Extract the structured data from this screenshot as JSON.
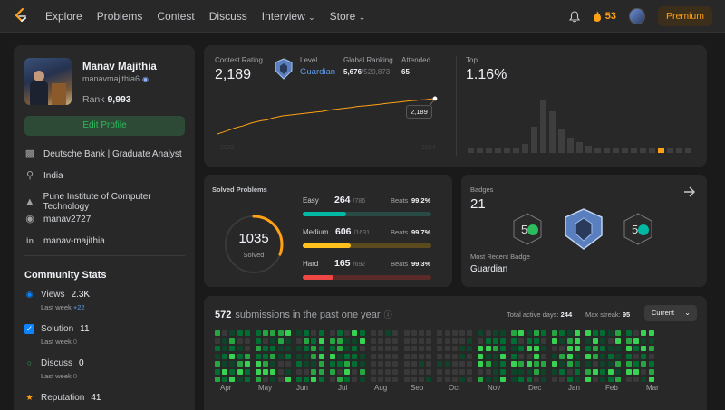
{
  "nav": {
    "links": [
      "Explore",
      "Problems",
      "Contest",
      "Discuss",
      "Interview",
      "Store"
    ],
    "streak": "53",
    "premium": "Premium"
  },
  "profile": {
    "name": "Manav Majithia",
    "username": "manavmajithia6",
    "rank_label": "Rank",
    "rank": "9,993",
    "edit_button": "Edit Profile",
    "company": "Deutsche Bank | Graduate Analyst",
    "location": "India",
    "school": "Pune Institute of Computer Technology",
    "github": "manav2727",
    "linkedin": "manav-majithia"
  },
  "community": {
    "title": "Community Stats",
    "last_week": "Last week",
    "items": [
      {
        "label": "Views",
        "value": "2.3K",
        "delta": "+22",
        "icon": "eye-icon",
        "color": "#0a84ff"
      },
      {
        "label": "Solution",
        "value": "11",
        "delta": "0",
        "icon": "checkbox-icon",
        "color": "#0a84ff"
      },
      {
        "label": "Discuss",
        "value": "0",
        "delta": "0",
        "icon": "chat-icon",
        "color": "#2cbb5d"
      },
      {
        "label": "Reputation",
        "value": "41",
        "delta": "",
        "icon": "star-icon",
        "color": "#ffa116"
      }
    ]
  },
  "contest": {
    "rating_label": "Contest Rating",
    "rating": "2,189",
    "level_label": "Level",
    "level": "Guardian",
    "global_label": "Global Ranking",
    "global_rank": "5,676",
    "global_total": "/520,873",
    "attended_label": "Attended",
    "attended": "65",
    "tooltip": "2,189",
    "x_start": "2022",
    "x_end": "2024",
    "top_label": "Top",
    "top_value": "1.16%"
  },
  "chart_data": [
    {
      "type": "line",
      "title": "Contest Rating",
      "x": [
        "2022",
        "2024"
      ],
      "series": [
        {
          "values": [
            1560,
            1590,
            1620,
            1650,
            1680,
            1700,
            1730,
            1760,
            1780,
            1800,
            1810,
            1840,
            1860,
            1880,
            1890,
            1900,
            1910,
            1920,
            1930,
            1940,
            1950,
            1960,
            1975,
            1990,
            2000,
            2010,
            2020,
            2030,
            2045,
            2055,
            2060,
            2070,
            2080,
            2090,
            2100,
            2110,
            2120,
            2130,
            2140,
            2150,
            2155,
            2165,
            2170,
            2180,
            2189
          ]
        }
      ],
      "ylim": [
        1400,
        2300
      ]
    },
    {
      "type": "bar",
      "title": "Top",
      "values": [
        2,
        2,
        2,
        2,
        2,
        3,
        8,
        24,
        48,
        38,
        22,
        14,
        10,
        7,
        5,
        4,
        4,
        3,
        3,
        3,
        2,
        2,
        2,
        2,
        2
      ],
      "highlight_index": 21
    }
  ],
  "solved": {
    "title": "Solved Problems",
    "total": "1035",
    "total_label": "Solved",
    "beats_label": "Beats",
    "items": [
      {
        "label": "Easy",
        "count": "264",
        "total": "/786",
        "beats": "99.2%",
        "color": "#00b8a3",
        "track": "#2a4a45",
        "fraction": 0.336
      },
      {
        "label": "Medium",
        "count": "606",
        "total": "/1631",
        "beats": "99.7%",
        "color": "#ffc01e",
        "track": "#5a4a1e",
        "fraction": 0.372
      },
      {
        "label": "Hard",
        "count": "165",
        "total": "/692",
        "beats": "99.3%",
        "color": "#ef4743",
        "track": "#5a2a28",
        "fraction": 0.238
      }
    ]
  },
  "badges": {
    "title": "Badges",
    "count": "21",
    "recent_label": "Most Recent Badge",
    "recent": "Guardian"
  },
  "submissions": {
    "count": "572",
    "text": "submissions in the past one year",
    "active_label": "Total active days:",
    "active_days": "244",
    "streak_label": "Max streak:",
    "max_streak": "95",
    "dropdown": "Current",
    "months": [
      "Apr",
      "May",
      "Jun",
      "Jul",
      "Aug",
      "Sep",
      "Oct",
      "Nov",
      "Dec",
      "Jan",
      "Feb",
      "Mar"
    ]
  }
}
